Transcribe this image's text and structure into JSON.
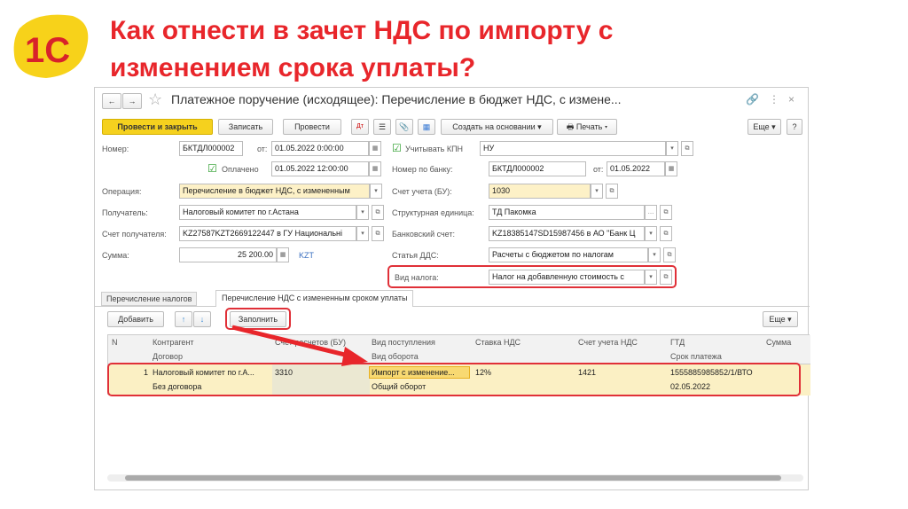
{
  "slide": {
    "title_line1": "Как отнести в зачет НДС по импорту с",
    "title_line2": "изменением срока уплаты?",
    "logo_text": "1С"
  },
  "window": {
    "title": "Платежное поручение (исходящее): Перечисление в бюджет НДС, с измене...",
    "toolbar": {
      "post_close": "Провести и закрыть",
      "save": "Записать",
      "post": "Провести",
      "create_based": "Создать на основании",
      "print": "Печать",
      "more": "Еще",
      "help": "?"
    }
  },
  "form": {
    "number_label": "Номер:",
    "number": "БКТДЛ000002",
    "from_label": "от:",
    "date": "01.05.2022  0:00:00",
    "kpn_label": "Учитывать КПН",
    "kpn_value": "НУ",
    "paid_label": "Оплачено",
    "paid_date": "01.05.2022 12:00:00",
    "bank_num_label": "Номер по банку:",
    "bank_num": "БКТДЛ000002",
    "bank_from_label": "от:",
    "bank_date": "01.05.2022",
    "operation_label": "Операция:",
    "operation": "Перечисление в бюджет НДС, с измененным",
    "account_bu_label": "Счет учета (БУ):",
    "account_bu": "1030",
    "recipient_label": "Получатель:",
    "recipient": "Налоговый комитет по г.Астана",
    "unit_label": "Структурная единица:",
    "unit": "ТД Пакомка",
    "recipient_acc_label": "Счет получателя:",
    "recipient_acc": "KZ27587KZT2669122447 в ГУ Национальні",
    "bank_acc_label": "Банковский счет:",
    "bank_acc": "KZ18385147SD15987456 в АО \"Банк Ц",
    "sum_label": "Сумма:",
    "sum": "25 200.00",
    "currency": "KZT",
    "dds_label": "Статья ДДС:",
    "dds": "Расчеты с бюджетом по налогам",
    "tax_type_label": "Вид налога:",
    "tax_type": "Налог на добавленную стоимость с"
  },
  "tabs": [
    {
      "label": "Перечисление налогов"
    },
    {
      "label": "Перечисление НДС с измененным сроком уплаты"
    }
  ],
  "table_toolbar": {
    "add": "Добавить",
    "fill": "Заполнить",
    "more": "Еще"
  },
  "table": {
    "headers": {
      "n": "N",
      "counterparty": "Контрагент",
      "contract": "Договор",
      "settle_acc": "Счет расчетов (БУ)",
      "receipt_type": "Вид поступления",
      "turnover_type": "Вид оборота",
      "vat_rate": "Ставка НДС",
      "vat_acc": "Счет учета НДС",
      "gtd": "ГТД",
      "due_date": "Срок платежа",
      "amount": "Сумма"
    },
    "rows": [
      {
        "n": "1",
        "counterparty": "Налоговый комитет по г.А...",
        "contract": "Без договора",
        "settle_acc": "3310",
        "receipt_type": "Импорт с изменение...",
        "turnover_type": "Общий оборот",
        "vat_rate": "12%",
        "vat_acc": "1421",
        "gtd": "1555885985852/1/ВТО",
        "due_date": "02.05.2022"
      }
    ]
  }
}
